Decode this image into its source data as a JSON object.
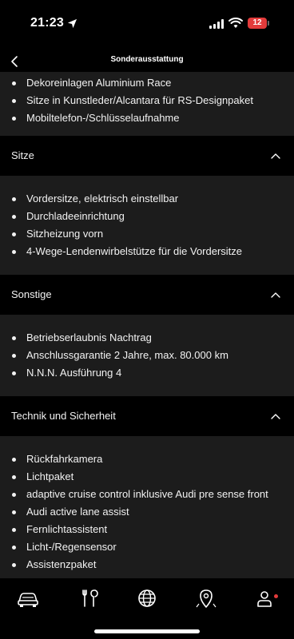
{
  "status_bar": {
    "time": "21:23",
    "battery": "12"
  },
  "header": {
    "title": "Sonderausstattung"
  },
  "sections": [
    {
      "items": [
        "Dekoreinlagen Aluminium Race",
        "Sitze in Kunstleder/Alcantara für RS-Designpaket",
        "Mobiltelefon-/Schlüsselaufnahme"
      ]
    },
    {
      "title": "Sitze",
      "items": [
        "Vordersitze, elektrisch einstellbar",
        "Durchladeeinrichtung",
        "Sitzheizung vorn",
        "4-Wege-Lendenwirbelstütze für die Vordersitze"
      ]
    },
    {
      "title": "Sonstige",
      "items": [
        "Betriebserlaubnis Nachtrag",
        "Anschlussgarantie 2 Jahre, max. 80.000 km",
        "N.N.N. Ausführung 4"
      ]
    },
    {
      "title": "Technik und Sicherheit",
      "items": [
        "Rückfahrkamera",
        "Lichtpaket",
        "adaptive cruise control inklusive Audi pre sense front",
        "Audi active lane assist",
        "Fernlichtassistent",
        "Licht-/Regensensor",
        "Assistenzpaket"
      ]
    }
  ],
  "tab_bar": {
    "icons": [
      "car-icon",
      "tools-icon",
      "globe-icon",
      "map-pin-icon",
      "user-icon"
    ]
  },
  "colors": {
    "background": "#000000",
    "card": "#1c1c1c",
    "badge": "#e33b3b"
  }
}
